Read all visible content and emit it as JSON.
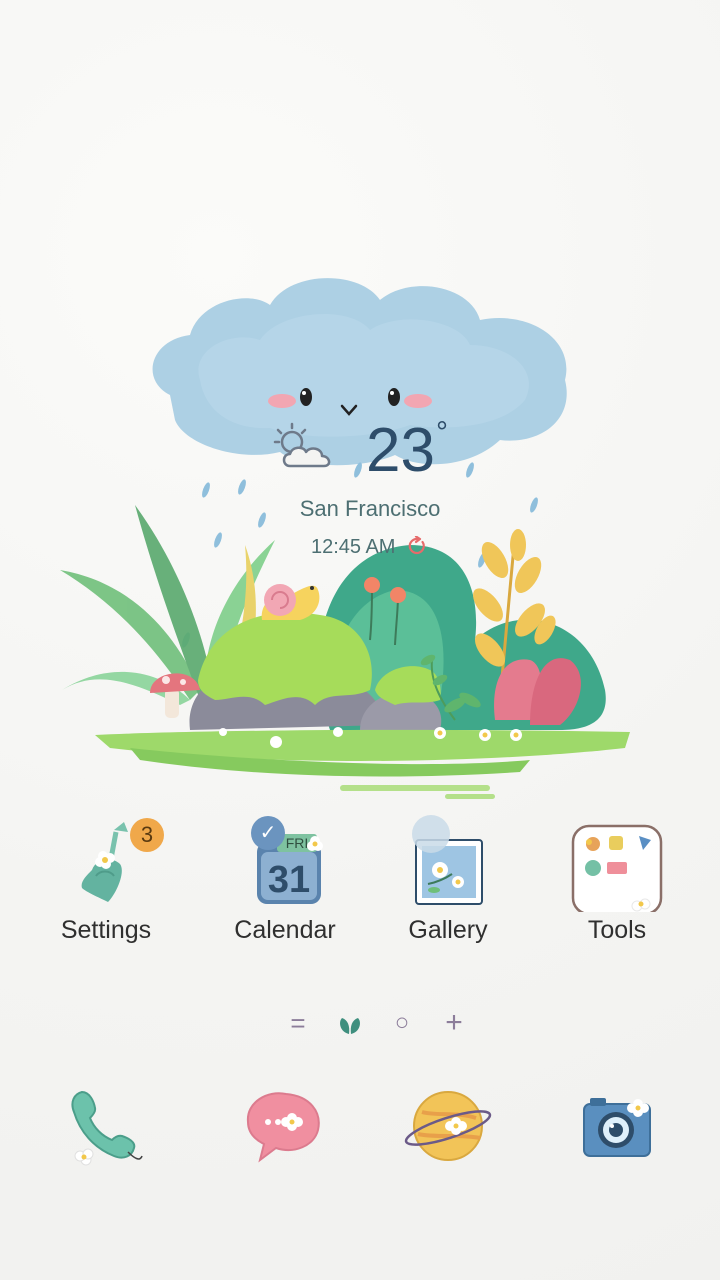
{
  "weather": {
    "temperature": "23",
    "degree_symbol": "°",
    "location": "San Francisco",
    "time": "12:45 AM",
    "condition_icon": "partly-cloudy-icon",
    "refresh_icon": "refresh-icon"
  },
  "apps": [
    {
      "label": "Settings",
      "icon": "settings-icon",
      "badge": "3"
    },
    {
      "label": "Calendar",
      "icon": "calendar-icon",
      "day_name": "FRI",
      "day_number": "31",
      "status_icon": "check-icon"
    },
    {
      "label": "Gallery",
      "icon": "gallery-icon"
    },
    {
      "label": "Tools",
      "icon": "tools-folder-icon"
    }
  ],
  "page_indicators": [
    {
      "icon": "menu-lines-icon",
      "symbol": "="
    },
    {
      "icon": "leaf-icon",
      "symbol": "",
      "active": true
    },
    {
      "icon": "circle-icon",
      "symbol": "○"
    },
    {
      "icon": "plus-icon",
      "symbol": "+"
    }
  ],
  "dock": [
    {
      "icon": "phone-icon"
    },
    {
      "icon": "messages-icon"
    },
    {
      "icon": "browser-planet-icon"
    },
    {
      "icon": "camera-icon"
    }
  ],
  "colors": {
    "background": "#f4f4f2",
    "temperature_text": "#2e4d6a",
    "location_text": "#4d6f72",
    "label_text": "#2f2f2f",
    "badge": "#f0a84a",
    "check_badge": "#6b94bf",
    "indicator": "#8c7d9a",
    "active_indicator": "#3f8f7e"
  }
}
